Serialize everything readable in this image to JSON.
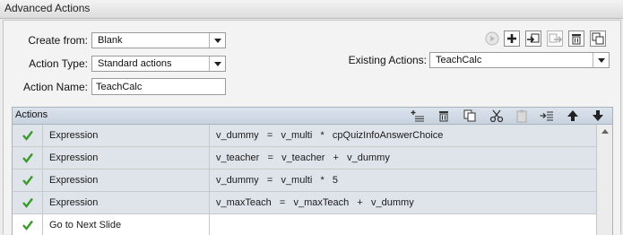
{
  "window": {
    "title": "Advanced Actions"
  },
  "form": {
    "create_from_label": "Create from:",
    "create_from_value": "Blank",
    "action_type_label": "Action Type:",
    "action_type_value": "Standard actions",
    "action_name_label": "Action Name:",
    "action_name_value": "TeachCalc",
    "existing_actions_label": "Existing Actions:",
    "existing_actions_value": "TeachCalc"
  },
  "toolbar": {
    "icons": [
      "preview-icon",
      "add-icon",
      "import-icon",
      "export-icon",
      "delete-icon",
      "duplicate-icon"
    ]
  },
  "actions": {
    "header": "Actions",
    "header_icons": [
      "add-row-icon",
      "delete-row-icon",
      "copy-row-icon",
      "cut-row-icon",
      "paste-row-icon",
      "insert-row-icon",
      "move-up-icon",
      "move-down-icon"
    ],
    "rows": [
      {
        "type": "Expression",
        "expr": "v_dummy   =   v_multi   *   cpQuizInfoAnswerChoice"
      },
      {
        "type": "Expression",
        "expr": "v_teacher   =   v_teacher   +   v_dummy"
      },
      {
        "type": "Expression",
        "expr": "v_dummy   =   v_multi   *   5"
      },
      {
        "type": "Expression",
        "expr": "v_maxTeach   =   v_maxTeach   +   v_dummy"
      },
      {
        "type": "Go to Next Slide",
        "expr": ""
      }
    ]
  },
  "colors": {
    "check": "#3a9a2a",
    "row_alt": "#dfe4ea",
    "header": "#c9d3df"
  }
}
